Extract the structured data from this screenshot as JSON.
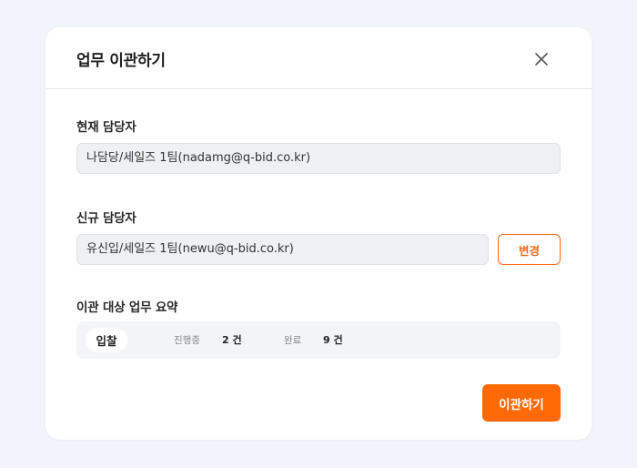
{
  "modal": {
    "title": "업무 이관하기",
    "close_icon": "close-icon"
  },
  "current_owner": {
    "label": "현재 담당자",
    "value": "나담당/세일즈 1팀(nadamg@q-bid.co.kr)"
  },
  "new_owner": {
    "label": "신규 담당자",
    "value": "유신입/세일즈 1팀(newu@q-bid.co.kr)",
    "change_label": "변경"
  },
  "summary": {
    "label": "이관 대상 업무 요약",
    "category": "입찰",
    "in_progress_label": "진행중",
    "in_progress_value": "2 건",
    "done_label": "완료",
    "done_value": "9 건"
  },
  "actions": {
    "submit_label": "이관하기"
  },
  "colors": {
    "accent": "#ff6a06",
    "page_bg": "#f1f4fb"
  }
}
